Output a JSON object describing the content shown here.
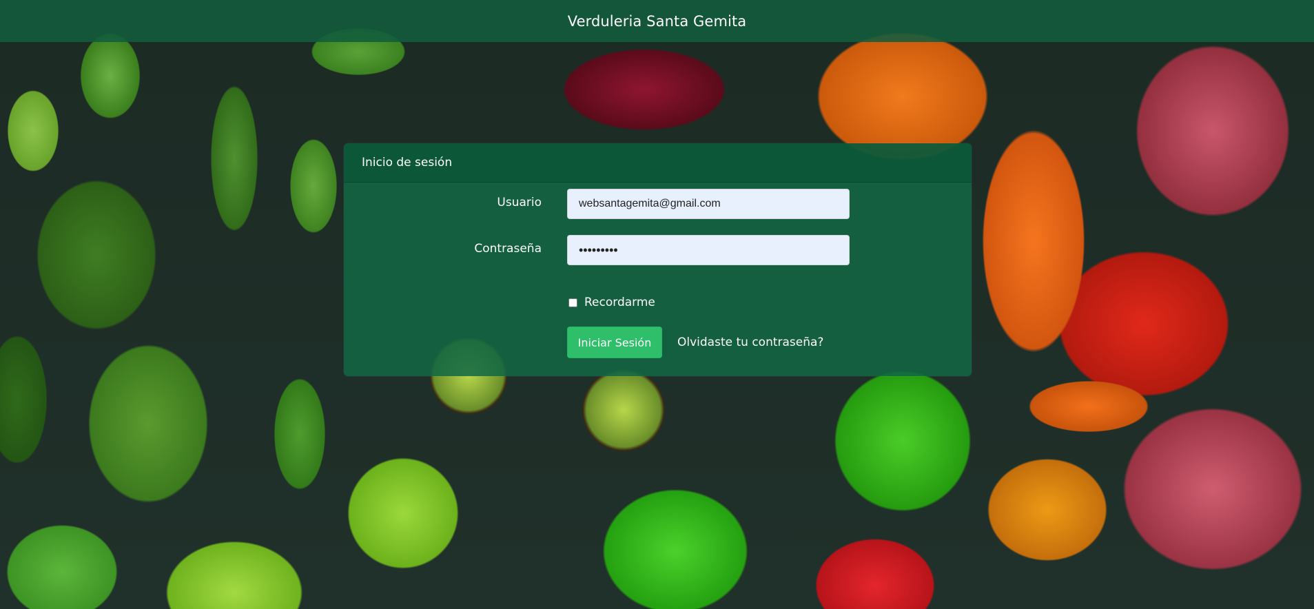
{
  "header": {
    "brand": "Verduleria Santa Gemita"
  },
  "login": {
    "title": "Inicio de sesión",
    "user_label": "Usuario",
    "user_value": "websantagemita@gmail.com",
    "password_label": "Contraseña",
    "password_value": "•••••••••",
    "remember_label": "Recordarme",
    "remember_checked": false,
    "submit_label": "Iniciar Sesión",
    "forgot_label": "Olvidaste tu contraseña?"
  },
  "colors": {
    "header_bg": "#125c3e",
    "card_bg": "#126844",
    "button_bg": "#2fbf6b",
    "input_bg": "#e8f0fe"
  }
}
